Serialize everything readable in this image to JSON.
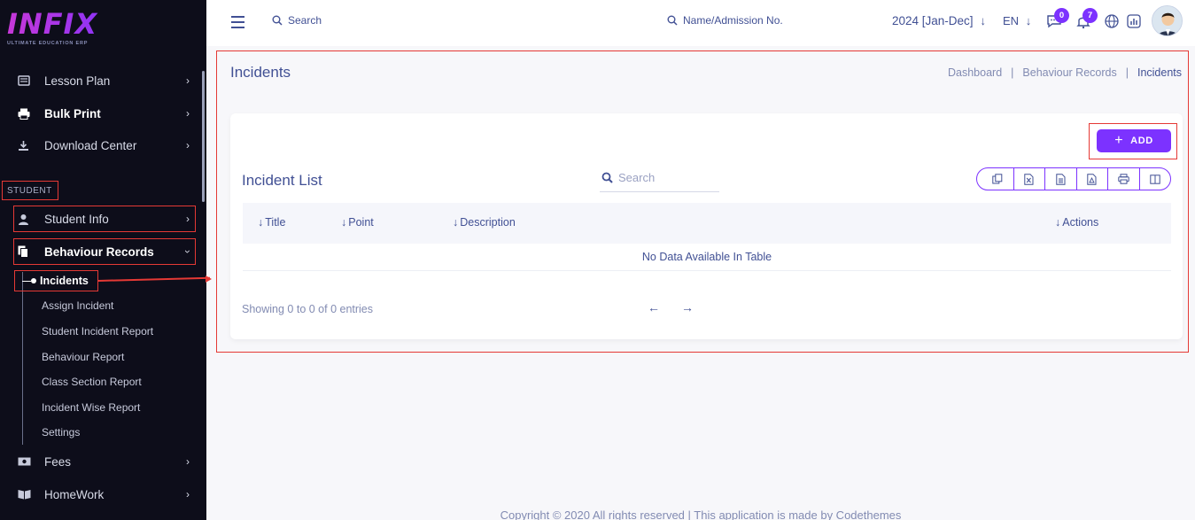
{
  "brand": {
    "name": "INFIX",
    "tagline": "ULTIMATE EDUCATION ERP"
  },
  "sidebar": {
    "items_top": [
      {
        "label": "Lesson Plan",
        "icon": "book-icon"
      },
      {
        "label": "Bulk Print",
        "icon": "printer-icon"
      },
      {
        "label": "Download Center",
        "icon": "download-icon"
      }
    ],
    "section_label": "STUDENT",
    "student_info": {
      "label": "Student Info",
      "icon": "user-icon"
    },
    "behaviour_records": {
      "label": "Behaviour Records",
      "icon": "copy-icon"
    },
    "sub_items": [
      "Incidents",
      "Assign Incident",
      "Student Incident Report",
      "Behaviour Report",
      "Class Section Report",
      "Incident Wise Report",
      "Settings"
    ],
    "items_bottom": [
      {
        "label": "Fees",
        "icon": "money-icon"
      },
      {
        "label": "HomeWork",
        "icon": "book-open-icon"
      }
    ]
  },
  "header": {
    "search_label": "Search",
    "student_search_label": "Name/Admission No.",
    "year": "2024 [Jan-Dec]",
    "language": "EN",
    "messages_count": "0",
    "notifications_count": "7"
  },
  "page": {
    "title": "Incidents",
    "breadcrumb": [
      "Dashboard",
      "Behaviour Records",
      "Incidents"
    ]
  },
  "card": {
    "add_label": "ADD",
    "title": "Incident List",
    "search_placeholder": "Search",
    "export_buttons": [
      "copy-icon",
      "excel-icon",
      "csv-icon",
      "pdf-icon",
      "print-icon",
      "columns-icon"
    ],
    "columns": [
      "Title",
      "Point",
      "Description",
      "Actions"
    ],
    "empty_text": "No Data Available In Table",
    "showing_text": "Showing 0 to 0 of 0 entries"
  },
  "footer": {
    "text": "Copyright © 2020 All rights reserved | This application is made by Codethemes"
  },
  "colors": {
    "accent": "#7c32ff",
    "sidebar_bg": "#0d0d1a",
    "text": "#415094",
    "highlight": "#e53935"
  }
}
